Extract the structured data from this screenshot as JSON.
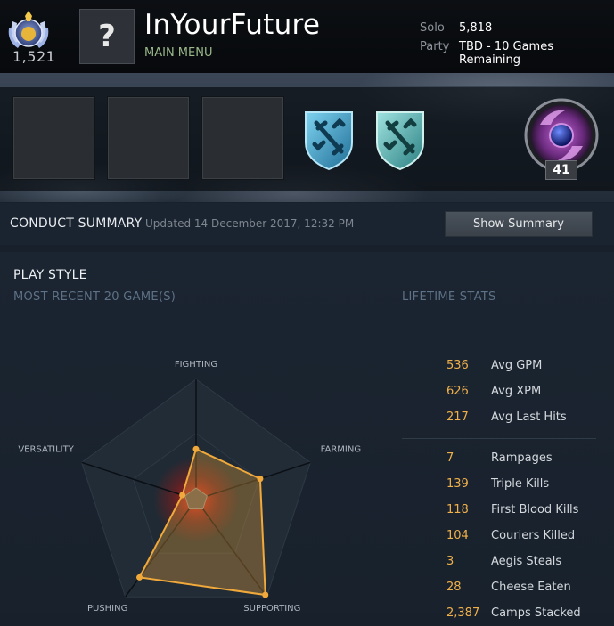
{
  "header": {
    "rank_number": "1,521",
    "avatar_glyph": "?",
    "player_name": "InYourFuture",
    "subtitle": "MAIN MENU",
    "solo_label": "Solo",
    "solo_value": "5,818",
    "party_label": "Party",
    "party_value": "TBD - 10 Games Remaining"
  },
  "medals": {
    "level": "41",
    "badge_icons": [
      "rank-medal-icon",
      "dota-shield-icon",
      "dota-shield-icon",
      "level-ring-icon"
    ]
  },
  "conduct": {
    "title": "CONDUCT SUMMARY",
    "updated": "Updated 14 December 2017, 12:32 PM",
    "button_label": "Show Summary"
  },
  "playstyle": {
    "title": "PLAY STYLE",
    "recent_label": "MOST RECENT 20 GAME(S)",
    "lifetime_label": "LIFETIME STATS",
    "radar_axes": [
      "FIGHTING",
      "FARMING",
      "SUPPORTING",
      "PUSHING",
      "VERSATILITY"
    ],
    "radar_values": [
      0.42,
      0.56,
      0.98,
      0.8,
      0.12
    ],
    "accent_color": "#f0a93a"
  },
  "lifetime_stats": {
    "group1": [
      {
        "value": "536",
        "label": "Avg GPM"
      },
      {
        "value": "626",
        "label": "Avg XPM"
      },
      {
        "value": "217",
        "label": "Avg Last Hits"
      }
    ],
    "group2": [
      {
        "value": "7",
        "label": "Rampages"
      },
      {
        "value": "139",
        "label": "Triple Kills"
      },
      {
        "value": "118",
        "label": "First Blood Kills"
      },
      {
        "value": "104",
        "label": "Couriers Killed"
      },
      {
        "value": "3",
        "label": "Aegis Steals"
      },
      {
        "value": "28",
        "label": "Cheese Eaten"
      },
      {
        "value": "2,387",
        "label": "Camps Stacked"
      }
    ]
  }
}
